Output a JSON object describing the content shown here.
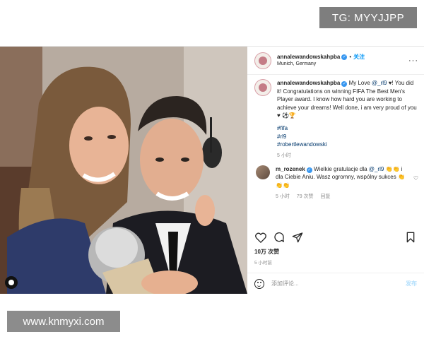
{
  "watermarks": {
    "tg": "TG: MYYJJPP",
    "site": "www.knmyxi.com"
  },
  "post": {
    "header": {
      "username": "annalewandowskahpba",
      "follow": "关注",
      "location": "Munich, Germany",
      "more": "···"
    },
    "caption": {
      "username": "annalewandowskahpba",
      "text_before": " My Love ",
      "mention": "@_rl9",
      "text_after": " ♥! You did it! Congratulations on winning FIFA The Best Men's Player award. I know how hard you are working to achieve your dreams! Well done, i am very proud of you ♥ ⚽🏆",
      "hashtags": [
        "#fifa",
        "#rl9",
        "#robertlewandowski"
      ],
      "time": "5 小时"
    },
    "comment": {
      "username": "m_rozenek",
      "text_before": " Wielkie gratulacje dla ",
      "mention": "@_rl9",
      "text_after": " 👏👏 i dla Ciebie Aniu. Wasz ogromny, wspólny sukces 👏👏👏",
      "time": "5 小时",
      "likes": "79 次赞",
      "reply": "回复"
    },
    "likes": "10万 次赞",
    "time": "5 小时前",
    "add_comment_placeholder": "添加评论...",
    "post_button": "发布"
  },
  "icons": [
    "heart-icon",
    "comment-icon",
    "share-icon",
    "bookmark-icon",
    "emoji-icon",
    "verified-icon",
    "tag-user-icon"
  ]
}
